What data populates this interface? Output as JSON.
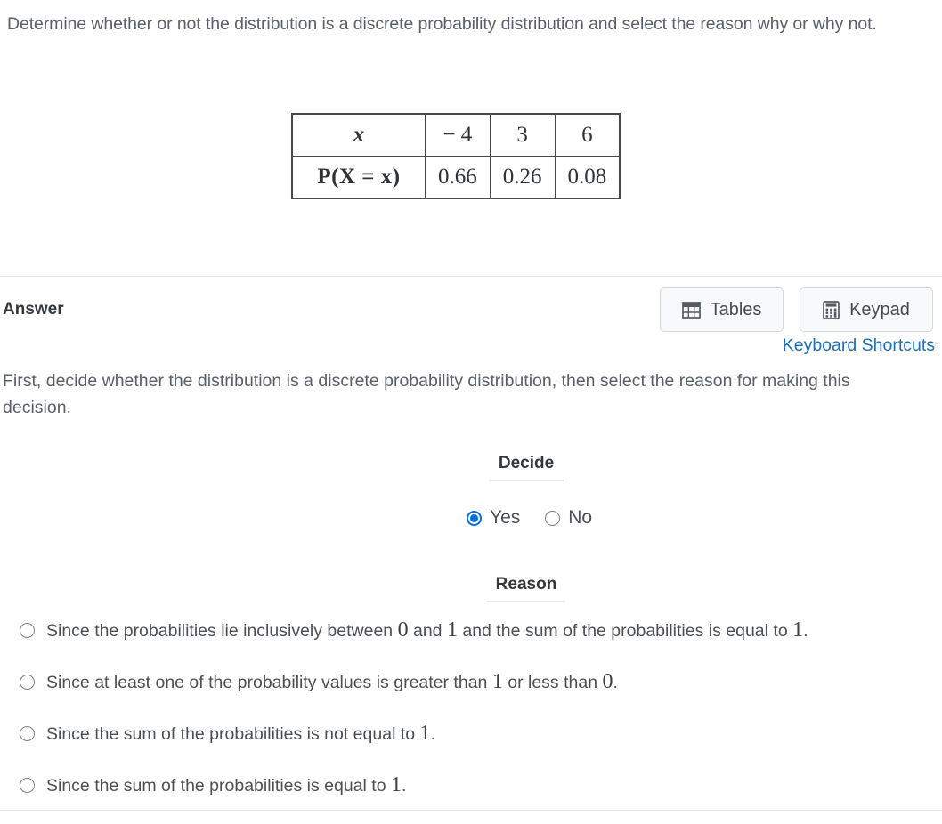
{
  "question": {
    "prompt": "Determine whether or not the distribution is a discrete probability distribution and select the reason why or why not."
  },
  "distribution_table": {
    "row_labels": [
      "x",
      "P(X  =  x)"
    ],
    "x_values": [
      "− 4",
      "3",
      "6"
    ],
    "probabilities": [
      "0.66",
      "0.26",
      "0.08"
    ]
  },
  "answer_bar": {
    "title": "Answer",
    "tables_button": "Tables",
    "keypad_button": "Keypad",
    "keyboard_shortcuts": "Keyboard Shortcuts",
    "tables_icon": "table-grid-icon",
    "keypad_icon": "calculator-icon"
  },
  "instruction": "First, decide whether the distribution is a discrete probability distribution, then select the reason for making this decision.",
  "decide": {
    "heading": "Decide",
    "options": [
      {
        "label": "Yes",
        "selected": true
      },
      {
        "label": "No",
        "selected": false
      }
    ]
  },
  "reason": {
    "heading": "Reason",
    "options": [
      {
        "pre": "Since the probabilities lie inclusively between ",
        "n1": "0",
        "mid1": " and ",
        "n2": "1",
        "mid2": " and the sum of the probabilities is equal to ",
        "n3": "1",
        "post": ".",
        "selected": false
      },
      {
        "pre": "Since at least one of the probability values is greater than ",
        "n1": "1",
        "mid1": " or less than ",
        "n2": "0",
        "mid2": "",
        "n3": "",
        "post": ".",
        "selected": false
      },
      {
        "pre": "Since the sum of the probabilities is not equal to ",
        "n1": "1",
        "mid1": "",
        "n2": "",
        "mid2": "",
        "n3": "",
        "post": ".",
        "selected": false
      },
      {
        "pre": "Since the sum of the probabilities is equal to ",
        "n1": "1",
        "mid1": "",
        "n2": "",
        "mid2": "",
        "n3": "",
        "post": ".",
        "selected": false
      }
    ]
  },
  "colors": {
    "link": "#1f6fb5",
    "radio_selected": "#0b6ed8",
    "text": "#5a6069",
    "table_border": "#45494d"
  }
}
